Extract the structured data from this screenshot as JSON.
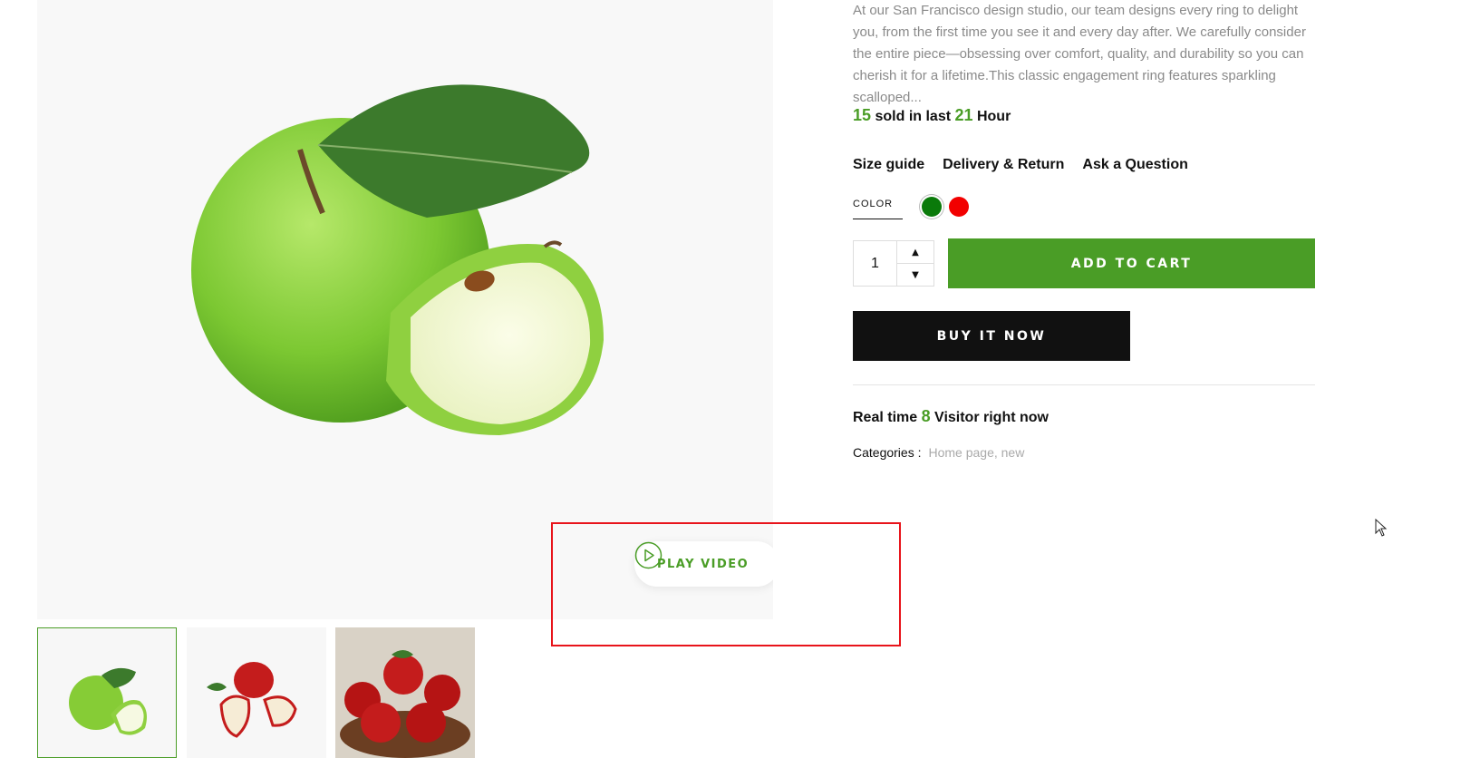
{
  "product": {
    "description": "At our San Francisco design studio, our team designs every ring to delight you, from the first time you see it and every day after. We carefully consider the entire piece—obsessing over comfort, quality, and durability so you can cherish it for a lifetime.This classic engagement ring features sparkling scalloped...",
    "sold": {
      "count": "15",
      "text_mid": " sold in last ",
      "hours": "21",
      "text_end": " Hour"
    },
    "links": [
      "Size guide",
      "Delivery & Return",
      "Ask a Question"
    ],
    "color_label": "COLOR",
    "colors": [
      {
        "name": "green",
        "hex": "#0a7a0a"
      },
      {
        "name": "red",
        "hex": "#f20000"
      }
    ],
    "quantity": "1",
    "add_to_cart_label": "ADD TO CART",
    "buy_now_label": "BUY IT NOW",
    "visitors": {
      "prefix": "Real time ",
      "count": "8",
      "suffix": " Visitor right now"
    },
    "categories": {
      "label": "Categories :",
      "values": "Home page, new"
    }
  },
  "gallery": {
    "play_video_label": "PLAY VIDEO",
    "thumbnails": [
      "green-apple",
      "red-apple-slices",
      "apple-bowl"
    ]
  },
  "colors": {
    "accent": "#4a9d26",
    "dark": "#111111",
    "highlight": "#e8141b"
  }
}
